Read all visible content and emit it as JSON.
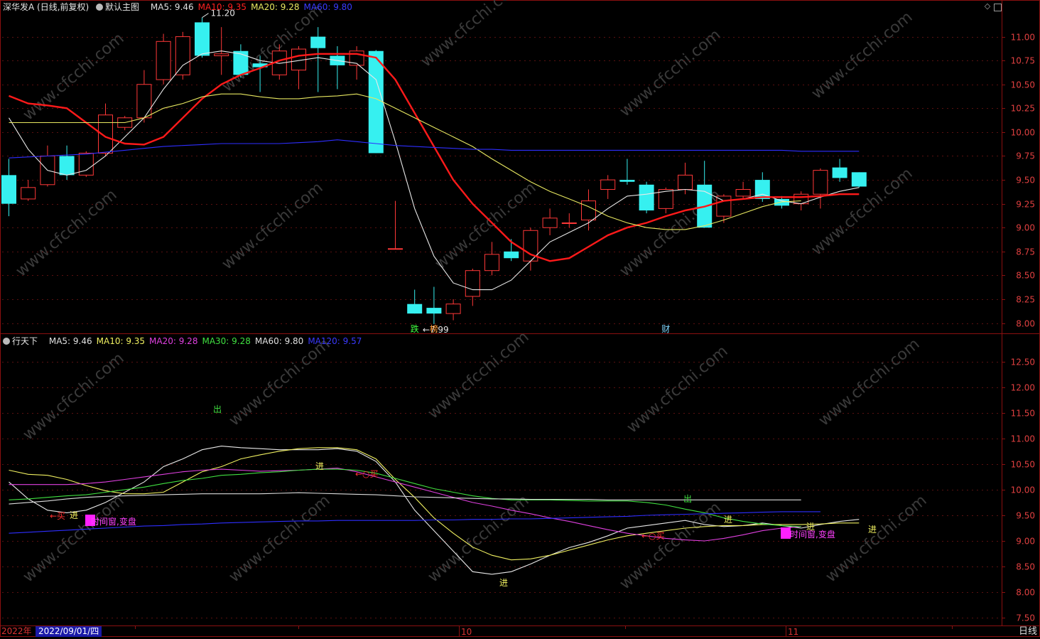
{
  "top_panel": {
    "title": "深华发A (日线,前复权)",
    "template_label": "默认主图",
    "ma": [
      {
        "label": "MA5: 9.46",
        "color": "#e0e0e0"
      },
      {
        "label": "MA10: 9.35",
        "color": "#ff2020"
      },
      {
        "label": "MA20: 9.28",
        "color": "#e8e860"
      },
      {
        "label": "MA60: 9.80",
        "color": "#3a3aff"
      }
    ],
    "high_label": "11.20",
    "low_label": "←7.99",
    "markers": [
      {
        "text": "跌",
        "color": "#40ff40",
        "candle": 21
      },
      {
        "text": "榜",
        "color": "#ff9933",
        "candle": 22
      },
      {
        "text": "财",
        "color": "#7fd7ff",
        "candle": 34
      }
    ]
  },
  "bottom_panel": {
    "title": "行天下",
    "ma": [
      {
        "label": "MA5: 9.46",
        "color": "#e0e0e0"
      },
      {
        "label": "MA10: 9.35",
        "color": "#f0f060"
      },
      {
        "label": "MA20: 9.28",
        "color": "#e040e0"
      },
      {
        "label": "MA30: 9.28",
        "color": "#40e040"
      },
      {
        "label": "MA60: 9.80",
        "color": "#e0e0e0"
      },
      {
        "label": "MA120: 9.57",
        "color": "#3a3aff"
      }
    ],
    "annotations": [
      {
        "text": "出",
        "color": "#40e040",
        "x": 300,
        "y": 580
      },
      {
        "text": "进",
        "color": "#f0f060",
        "x": 444,
        "y": 660
      },
      {
        "text": "←○买",
        "color": "#ff3030",
        "x": 500,
        "y": 671
      },
      {
        "text": "←买",
        "color": "#ff3030",
        "x": 70,
        "y": 730
      },
      {
        "text": "进",
        "color": "#f0f060",
        "x": 98,
        "y": 729
      },
      {
        "text": "时间窗,变盘",
        "color": "#ff40ff",
        "x": 128,
        "y": 738
      },
      {
        "text": "出",
        "color": "#40e040",
        "x": 962,
        "y": 706
      },
      {
        "text": "←○买",
        "color": "#ff3030",
        "x": 903,
        "y": 758
      },
      {
        "text": "进",
        "color": "#f0f060",
        "x": 1019,
        "y": 735
      },
      {
        "text": "时间窗,变盘",
        "color": "#ff40ff",
        "x": 1112,
        "y": 756
      },
      {
        "text": "进",
        "color": "#f0f060",
        "x": 1135,
        "y": 745
      },
      {
        "text": "进",
        "color": "#f0f060",
        "x": 1222,
        "y": 749
      },
      {
        "text": "进",
        "color": "#f0f060",
        "x": 703,
        "y": 824
      }
    ]
  },
  "footer": {
    "year_label": "2022年",
    "date_box": "2022/09/01/四",
    "month_ticks": [
      {
        "text": "10",
        "x": 646
      },
      {
        "text": "11",
        "x": 1106
      }
    ],
    "period": "日线"
  },
  "watermark": "www.cfcchi.com",
  "colors": {
    "up": "#ff3838",
    "down": "#36f0f0",
    "axis": "#8b1010",
    "grid": "#5a1010"
  },
  "chart_data": [
    {
      "type": "candlestick",
      "title": "深华发A (日线,前复权)",
      "ylim": [
        7.9,
        11.25
      ],
      "yticks": [
        8.0,
        8.25,
        8.5,
        8.75,
        9.0,
        9.25,
        9.5,
        9.75,
        10.0,
        10.25,
        10.5,
        10.75,
        11.0
      ],
      "candles": [
        {
          "o": 9.55,
          "c": 9.25,
          "h": 9.72,
          "l": 9.12
        },
        {
          "o": 9.3,
          "c": 9.42,
          "h": 9.5,
          "l": 9.28
        },
        {
          "o": 9.45,
          "c": 9.75,
          "h": 9.86,
          "l": 9.43
        },
        {
          "o": 9.75,
          "c": 9.55,
          "h": 9.86,
          "l": 9.5
        },
        {
          "o": 9.55,
          "c": 9.78,
          "h": 9.8,
          "l": 9.53
        },
        {
          "o": 9.78,
          "c": 10.18,
          "h": 10.3,
          "l": 9.75
        },
        {
          "o": 10.05,
          "c": 10.15,
          "h": 10.17,
          "l": 10.02
        },
        {
          "o": 10.15,
          "c": 10.5,
          "h": 10.65,
          "l": 10.1
        },
        {
          "o": 10.55,
          "c": 10.95,
          "h": 11.03,
          "l": 10.5
        },
        {
          "o": 10.6,
          "c": 11.0,
          "h": 11.05,
          "l": 10.55
        },
        {
          "o": 11.15,
          "c": 10.8,
          "h": 11.2,
          "l": 10.78
        },
        {
          "o": 10.8,
          "c": 10.82,
          "h": 11.1,
          "l": 10.6
        },
        {
          "o": 10.85,
          "c": 10.6,
          "h": 10.92,
          "l": 10.57
        },
        {
          "o": 10.72,
          "c": 10.68,
          "h": 10.8,
          "l": 10.42
        },
        {
          "o": 10.6,
          "c": 10.85,
          "h": 10.92,
          "l": 10.55
        },
        {
          "o": 10.65,
          "c": 10.87,
          "h": 10.9,
          "l": 10.45
        },
        {
          "o": 11.0,
          "c": 10.88,
          "h": 11.1,
          "l": 10.42
        },
        {
          "o": 10.8,
          "c": 10.7,
          "h": 10.9,
          "l": 10.45
        },
        {
          "o": 10.7,
          "c": 10.85,
          "h": 10.9,
          "l": 10.55
        },
        {
          "o": 10.85,
          "c": 9.78,
          "h": 10.86,
          "l": 9.78
        },
        {
          "o": 8.78,
          "c": 8.78,
          "h": 9.28,
          "l": 8.78
        },
        {
          "o": 8.2,
          "c": 8.1,
          "h": 8.35,
          "l": 8.1
        },
        {
          "o": 8.16,
          "c": 8.1,
          "h": 8.38,
          "l": 7.99
        },
        {
          "o": 8.1,
          "c": 8.2,
          "h": 8.25,
          "l": 8.03
        },
        {
          "o": 8.28,
          "c": 8.55,
          "h": 8.57,
          "l": 8.18
        },
        {
          "o": 8.55,
          "c": 8.72,
          "h": 8.85,
          "l": 8.5
        },
        {
          "o": 8.75,
          "c": 8.68,
          "h": 8.88,
          "l": 8.65
        },
        {
          "o": 8.65,
          "c": 8.97,
          "h": 9.0,
          "l": 8.55
        },
        {
          "o": 9.0,
          "c": 9.1,
          "h": 9.2,
          "l": 8.92
        },
        {
          "o": 9.05,
          "c": 9.05,
          "h": 9.15,
          "l": 9.0
        },
        {
          "o": 9.08,
          "c": 9.28,
          "h": 9.4,
          "l": 8.97
        },
        {
          "o": 9.4,
          "c": 9.5,
          "h": 9.55,
          "l": 9.3
        },
        {
          "o": 9.5,
          "c": 9.48,
          "h": 9.72,
          "l": 9.45
        },
        {
          "o": 9.45,
          "c": 9.18,
          "h": 9.48,
          "l": 9.15
        },
        {
          "o": 9.2,
          "c": 9.4,
          "h": 9.42,
          "l": 9.15
        },
        {
          "o": 9.4,
          "c": 9.55,
          "h": 9.68,
          "l": 9.35
        },
        {
          "o": 9.45,
          "c": 9.0,
          "h": 9.7,
          "l": 9.0
        },
        {
          "o": 9.12,
          "c": 9.33,
          "h": 9.35,
          "l": 9.05
        },
        {
          "o": 9.33,
          "c": 9.4,
          "h": 9.48,
          "l": 9.3
        },
        {
          "o": 9.5,
          "c": 9.3,
          "h": 9.58,
          "l": 9.27
        },
        {
          "o": 9.3,
          "c": 9.23,
          "h": 9.33,
          "l": 9.2
        },
        {
          "o": 9.25,
          "c": 9.35,
          "h": 9.38,
          "l": 9.18
        },
        {
          "o": 9.35,
          "c": 9.6,
          "h": 9.62,
          "l": 9.2
        },
        {
          "o": 9.63,
          "c": 9.52,
          "h": 9.72,
          "l": 9.48
        },
        {
          "o": 9.58,
          "c": 9.43,
          "h": 9.58,
          "l": 9.42
        }
      ],
      "series": [
        {
          "name": "MA5",
          "color": "#e8e8e8",
          "values": [
            10.15,
            9.82,
            9.6,
            9.55,
            9.6,
            9.75,
            9.95,
            10.15,
            10.45,
            10.7,
            10.82,
            10.85,
            10.82,
            10.75,
            10.72,
            10.75,
            10.78,
            10.75,
            10.72,
            10.55,
            9.9,
            9.2,
            8.7,
            8.42,
            8.35,
            8.35,
            8.45,
            8.65,
            8.85,
            8.95,
            9.05,
            9.2,
            9.33,
            9.35,
            9.38,
            9.4,
            9.38,
            9.28,
            9.3,
            9.35,
            9.28,
            9.25,
            9.32,
            9.38,
            9.42
          ]
        },
        {
          "name": "MA10",
          "color": "#ff1a1a",
          "values": [
            10.38,
            10.3,
            10.28,
            10.25,
            10.1,
            9.95,
            9.88,
            9.87,
            9.95,
            10.15,
            10.35,
            10.5,
            10.6,
            10.67,
            10.75,
            10.8,
            10.82,
            10.82,
            10.82,
            10.78,
            10.55,
            10.2,
            9.85,
            9.5,
            9.25,
            9.05,
            8.85,
            8.72,
            8.65,
            8.68,
            8.8,
            8.92,
            9.0,
            9.05,
            9.12,
            9.18,
            9.22,
            9.28,
            9.3,
            9.32,
            9.32,
            9.32,
            9.33,
            9.35,
            9.35
          ]
        },
        {
          "name": "MA20",
          "color": "#e8e860",
          "values": [
            10.1,
            10.1,
            10.1,
            10.1,
            10.1,
            10.1,
            10.1,
            10.15,
            10.25,
            10.3,
            10.37,
            10.4,
            10.4,
            10.37,
            10.35,
            10.35,
            10.37,
            10.38,
            10.4,
            10.35,
            10.25,
            10.15,
            10.05,
            9.95,
            9.85,
            9.72,
            9.6,
            9.48,
            9.38,
            9.3,
            9.22,
            9.12,
            9.05,
            9.0,
            8.98,
            8.98,
            9.02,
            9.08,
            9.15,
            9.22,
            9.27,
            9.28
          ]
        },
        {
          "name": "MA60",
          "color": "#2e2eff",
          "values": [
            9.73,
            9.74,
            9.75,
            9.76,
            9.77,
            9.79,
            9.81,
            9.83,
            9.85,
            9.86,
            9.87,
            9.88,
            9.88,
            9.88,
            9.88,
            9.89,
            9.9,
            9.92,
            9.9,
            9.88,
            9.86,
            9.85,
            9.84,
            9.83,
            9.82,
            9.82,
            9.81,
            9.81,
            9.81,
            9.81,
            9.81,
            9.81,
            9.81,
            9.81,
            9.81,
            9.81,
            9.81,
            9.81,
            9.81,
            9.81,
            9.81,
            9.8,
            9.8,
            9.8,
            9.8
          ]
        }
      ]
    },
    {
      "type": "line",
      "title": "行天下",
      "ylim": [
        7.35,
        12.8
      ],
      "yticks": [
        7.5,
        8.0,
        8.5,
        9.0,
        9.5,
        10.0,
        10.5,
        11.0,
        11.5,
        12.0,
        12.5
      ],
      "series": [
        {
          "name": "MA5",
          "color": "#e8e8e8",
          "values": [
            10.15,
            9.82,
            9.6,
            9.55,
            9.6,
            9.75,
            9.95,
            10.15,
            10.45,
            10.6,
            10.78,
            10.85,
            10.82,
            10.8,
            10.78,
            10.78,
            10.78,
            10.8,
            10.75,
            10.55,
            10.15,
            9.6,
            9.2,
            8.8,
            8.4,
            8.35,
            8.4,
            8.55,
            8.72,
            8.87,
            8.97,
            9.1,
            9.25,
            9.3,
            9.35,
            9.4,
            9.32,
            9.28,
            9.3,
            9.35,
            9.3,
            9.25,
            9.32,
            9.38,
            9.42
          ]
        },
        {
          "name": "MA10",
          "color": "#f0f060",
          "values": [
            10.38,
            10.3,
            10.28,
            10.2,
            10.08,
            9.98,
            9.92,
            9.92,
            9.95,
            10.15,
            10.35,
            10.45,
            10.6,
            10.68,
            10.75,
            10.8,
            10.82,
            10.82,
            10.78,
            10.6,
            10.2,
            9.85,
            9.45,
            9.15,
            8.88,
            8.72,
            8.63,
            8.65,
            8.72,
            8.82,
            8.92,
            9.02,
            9.1,
            9.15,
            9.2,
            9.25,
            9.28,
            9.3,
            9.3,
            9.32,
            9.32,
            9.32,
            9.33,
            9.35,
            9.35
          ]
        },
        {
          "name": "MA20",
          "color": "#e040e0",
          "values": [
            10.1,
            10.1,
            10.1,
            10.1,
            10.12,
            10.15,
            10.2,
            10.25,
            10.3,
            10.35,
            10.38,
            10.4,
            10.38,
            10.36,
            10.37,
            10.38,
            10.4,
            10.42,
            10.35,
            10.25,
            10.15,
            10.05,
            9.95,
            9.85,
            9.75,
            9.68,
            9.6,
            9.53,
            9.45,
            9.38,
            9.3,
            9.22,
            9.15,
            9.1,
            9.05,
            9.02,
            9.0,
            9.05,
            9.12,
            9.2,
            9.25,
            9.28
          ]
        },
        {
          "name": "MA30",
          "color": "#40e040",
          "values": [
            9.8,
            9.82,
            9.85,
            9.88,
            9.9,
            9.95,
            10.0,
            10.05,
            10.12,
            10.18,
            10.22,
            10.28,
            10.3,
            10.33,
            10.35,
            10.38,
            10.4,
            10.4,
            10.38,
            10.32,
            10.22,
            10.12,
            10.02,
            9.95,
            9.88,
            9.83,
            9.8,
            9.8,
            9.8,
            9.79,
            9.78,
            9.78,
            9.78,
            9.75,
            9.7,
            9.62,
            9.55,
            9.45,
            9.38,
            9.33,
            9.3,
            9.28
          ]
        },
        {
          "name": "MA60",
          "color": "#dcdcdc",
          "values": [
            9.72,
            9.75,
            9.78,
            9.82,
            9.85,
            9.87,
            9.88,
            9.89,
            9.9,
            9.91,
            9.92,
            9.92,
            9.92,
            9.92,
            9.93,
            9.94,
            9.93,
            9.92,
            9.91,
            9.9,
            9.88,
            9.86,
            9.85,
            9.84,
            9.83,
            9.82,
            9.82,
            9.81,
            9.81,
            9.81,
            9.81,
            9.8,
            9.8,
            9.8,
            9.8,
            9.8,
            9.8,
            9.8,
            9.8,
            9.8,
            9.8,
            9.8
          ]
        },
        {
          "name": "MA120",
          "color": "#2e2eff",
          "values": [
            9.15,
            9.17,
            9.19,
            9.21,
            9.23,
            9.25,
            9.27,
            9.29,
            9.3,
            9.32,
            9.33,
            9.35,
            9.36,
            9.37,
            9.38,
            9.39,
            9.39,
            9.4,
            9.4,
            9.4,
            9.4,
            9.4,
            9.41,
            9.41,
            9.42,
            9.42,
            9.43,
            9.43,
            9.44,
            9.45,
            9.46,
            9.47,
            9.48,
            9.5,
            9.51,
            9.52,
            9.53,
            9.54,
            9.55,
            9.56,
            9.57,
            9.57,
            9.57
          ]
        }
      ]
    }
  ]
}
